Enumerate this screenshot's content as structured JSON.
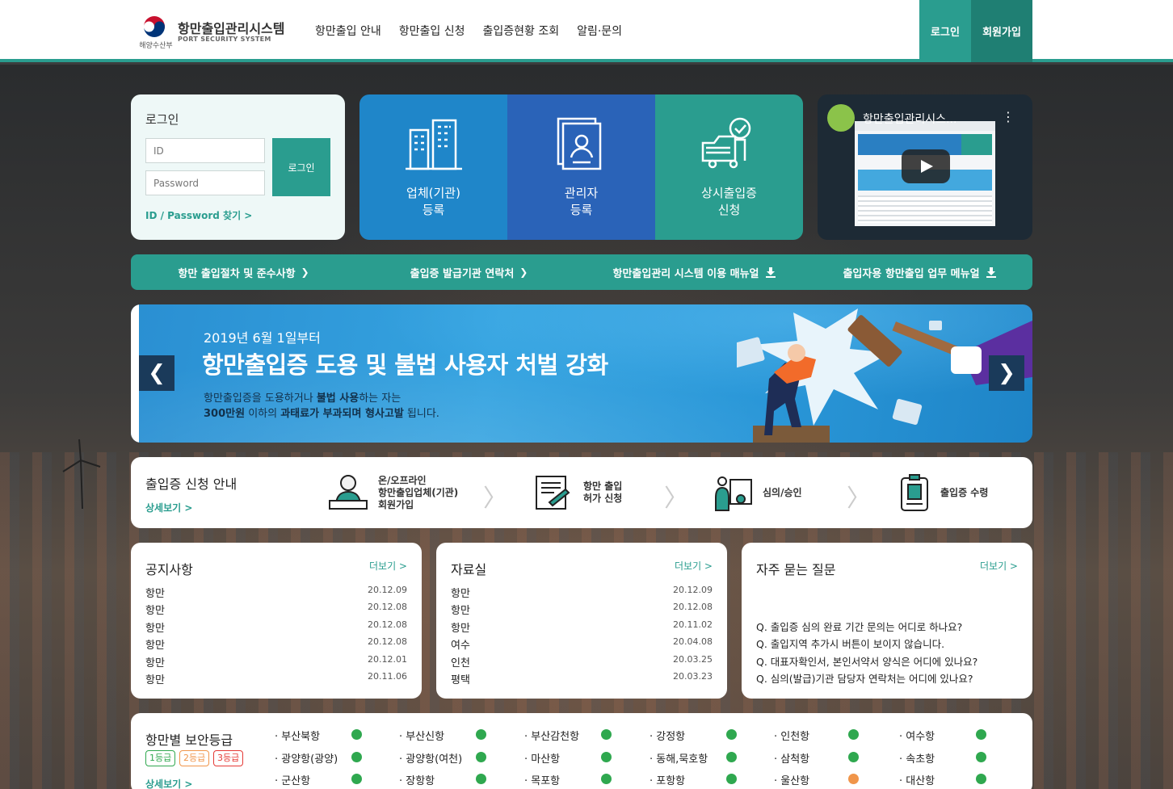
{
  "header": {
    "ministry": "해양수산부",
    "title": "항만출입관리시스템",
    "subtitle": "PORT SECURITY SYSTEM",
    "nav": [
      "항만출입 안내",
      "항만출입 신청",
      "출입증현황 조회",
      "알림·문의"
    ],
    "login": "로그인",
    "join": "회원가입"
  },
  "login_box": {
    "title": "로그인",
    "id_placeholder": "ID",
    "pw_placeholder": "Password",
    "button": "로그인",
    "find": "ID / Password 찾기 >"
  },
  "tiles": [
    {
      "line1": "업체(기관)",
      "line2": "등록",
      "icon": "building-icon"
    },
    {
      "line1": "관리자",
      "line2": "등록",
      "icon": "id-card-icon"
    },
    {
      "line1": "상시출입증",
      "line2": "신청",
      "icon": "truck-check-icon"
    }
  ],
  "video": {
    "title": "항만출입관리시스..."
  },
  "quick_links": [
    {
      "label": "항만 출입절차 및 준수사항",
      "icon": "chevron-right-icon"
    },
    {
      "label": "출입증 발급기관 연락처",
      "icon": "chevron-right-icon"
    },
    {
      "label": "항만출입관리 시스템 이용 매뉴얼",
      "icon": "download-icon"
    },
    {
      "label": "출입자용 항만출입 업무 메뉴얼",
      "icon": "download-icon"
    }
  ],
  "banner": {
    "date": "2019년 6월 1일부터",
    "headline": "항만출입증 도용 및 불법 사용자 처벌 강화",
    "line1_a": "항만출입증을 도용하거나 ",
    "line1_b": "불법 사용",
    "line1_c": "하는 자는",
    "line2_a": "300만원",
    "line2_b": " 이하의 ",
    "line2_c": "과태료가 부과되며 형사고발",
    "line2_d": " 됩니다."
  },
  "apply_guide": {
    "title": "출입증 신청 안내",
    "more": "상세보기 >",
    "steps": [
      {
        "l1": "온/오프라인",
        "l2": "항만출입업체(기관)",
        "l3": "회원가입"
      },
      {
        "l1": "항만 출입",
        "l2": "허가 신청",
        "l3": ""
      },
      {
        "l1": "심의/승인",
        "l2": "",
        "l3": ""
      },
      {
        "l1": "출입증 수령",
        "l2": "",
        "l3": ""
      }
    ]
  },
  "notices": {
    "title": "공지사항",
    "more": "더보기 >",
    "items": [
      {
        "t": "항만",
        "d": "20.12.09"
      },
      {
        "t": "항만",
        "d": "20.12.08"
      },
      {
        "t": "항만",
        "d": "20.12.08"
      },
      {
        "t": "항만",
        "d": "20.12.08"
      },
      {
        "t": "항만",
        "d": "20.12.01"
      },
      {
        "t": "항만",
        "d": "20.11.06"
      }
    ]
  },
  "archive": {
    "title": "자료실",
    "more": "더보기 >",
    "items": [
      {
        "t": "항만",
        "d": "20.12.09"
      },
      {
        "t": "항만",
        "d": "20.12.08"
      },
      {
        "t": "항만",
        "d": "20.11.02"
      },
      {
        "t": "여수",
        "d": "20.04.08"
      },
      {
        "t": "인천",
        "d": "20.03.25"
      },
      {
        "t": "평택",
        "d": "20.03.23"
      }
    ]
  },
  "faq": {
    "title": "자주 묻는 질문",
    "more": "더보기 >",
    "items": [
      "Q. 출입증 심의 완료 기간 문의는 어디로 하나요?",
      "Q. 출입지역 추가시 버튼이 보이지 않습니다.",
      "Q. 대표자확인서, 본인서약서 양식은 어디에 있나요?",
      "Q. 심의(발급)기관 담당자 연락처는 어디에 있나요?"
    ]
  },
  "security": {
    "title": "항만별 보안등급",
    "levels": [
      {
        "label": "1등급",
        "color": "#2fa84f"
      },
      {
        "label": "2등급",
        "color": "#f0954a"
      },
      {
        "label": "3등급",
        "color": "#e53935"
      }
    ],
    "more": "상세보기 >",
    "ports": [
      {
        "name": "· 부산북항",
        "level": 1
      },
      {
        "name": "· 부산신항",
        "level": 1
      },
      {
        "name": "· 부산감천항",
        "level": 1
      },
      {
        "name": "· 강정항",
        "level": 1
      },
      {
        "name": "· 인천항",
        "level": 1
      },
      {
        "name": "· 여수항",
        "level": 1
      },
      {
        "name": "· 광양항(광양)",
        "level": 1
      },
      {
        "name": "· 광양항(여천)",
        "level": 1
      },
      {
        "name": "· 마산항",
        "level": 1
      },
      {
        "name": "· 동해,묵호항",
        "level": 1
      },
      {
        "name": "· 삼척항",
        "level": 1
      },
      {
        "name": "· 속초항",
        "level": 1
      },
      {
        "name": "· 군산항",
        "level": 1
      },
      {
        "name": "· 장항항",
        "level": 1
      },
      {
        "name": "· 목포항",
        "level": 1
      },
      {
        "name": "· 포항항",
        "level": 1
      },
      {
        "name": "· 울산항",
        "level": 2
      },
      {
        "name": "· 대산항",
        "level": 1
      }
    ]
  }
}
